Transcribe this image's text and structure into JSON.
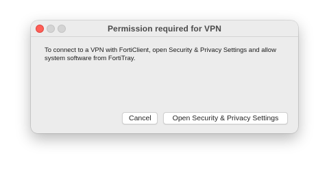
{
  "dialog": {
    "title": "Permission required for VPN",
    "message": "To connect to a VPN with FortiClient, open Security & Privacy Settings and allow system software from FortiTray.",
    "buttons": {
      "cancel": "Cancel",
      "open_settings": "Open Security & Privacy Settings"
    }
  },
  "colors": {
    "close_button": "#ff5f57",
    "window_background": "#ececec"
  }
}
